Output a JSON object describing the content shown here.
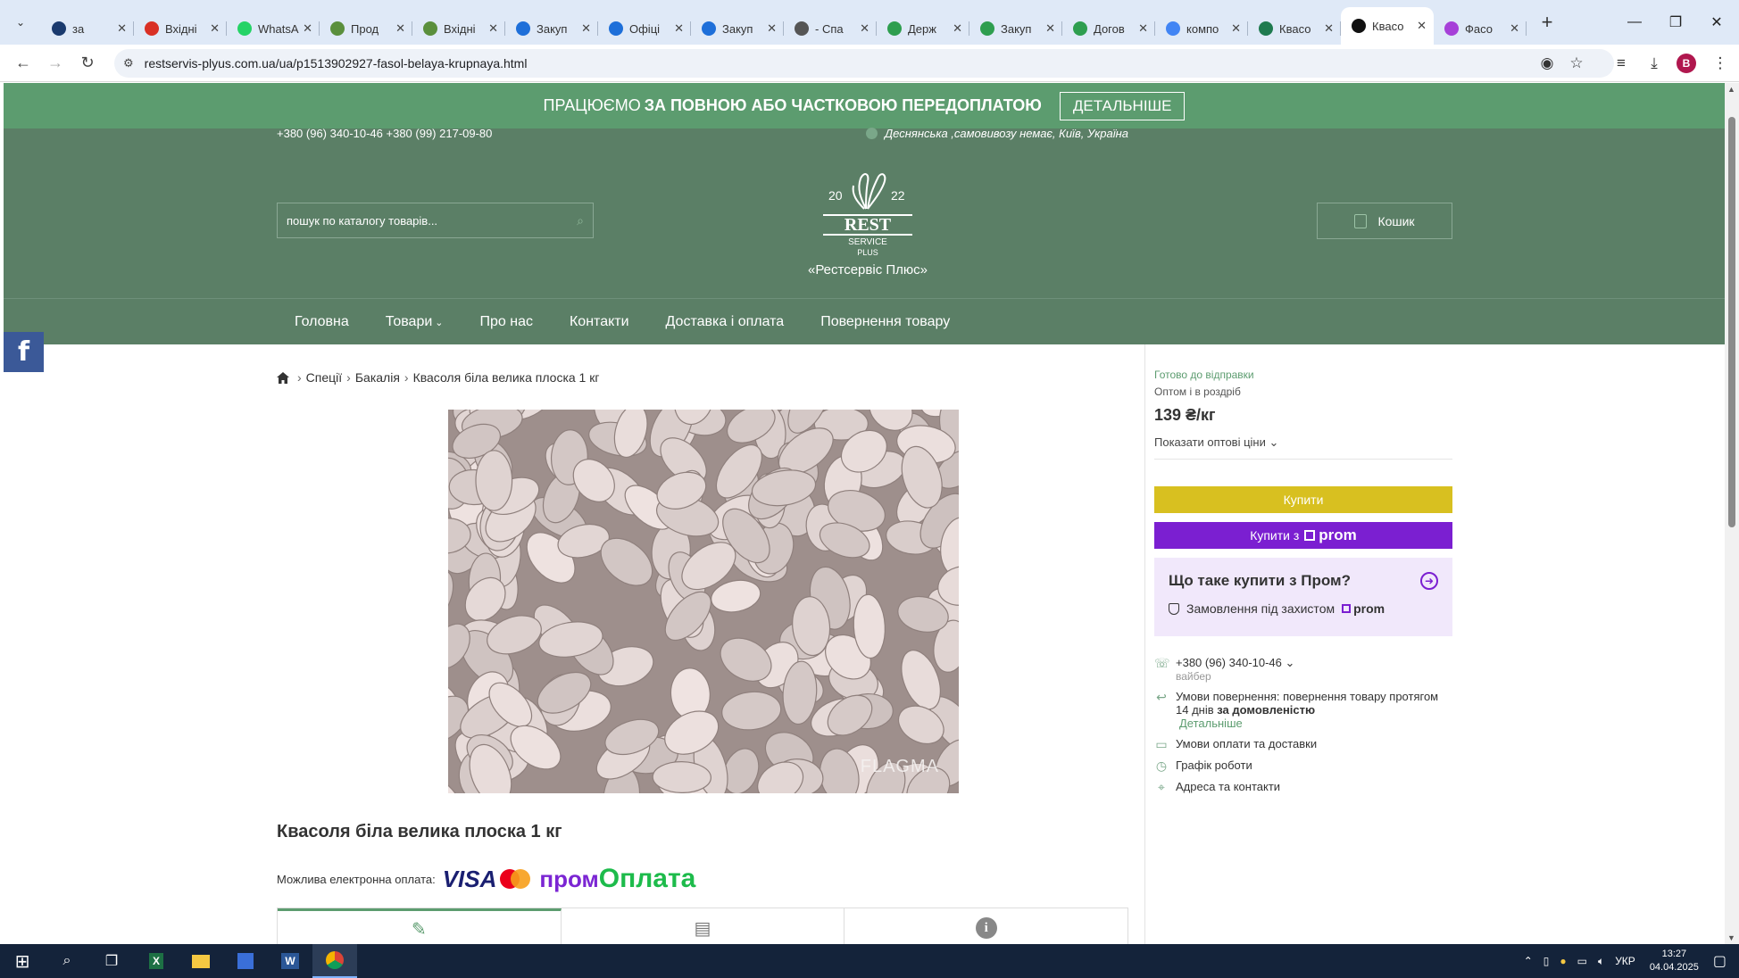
{
  "browser": {
    "tabs": [
      {
        "title": "за",
        "color": "#1a3a6e"
      },
      {
        "title": "Вхідні",
        "color": "#d93025"
      },
      {
        "title": "WhatsApp",
        "color": "#25d366"
      },
      {
        "title": "Прод",
        "color": "#5a8f3c"
      },
      {
        "title": "Вхідні",
        "color": "#5a8f3c"
      },
      {
        "title": "Закуп",
        "color": "#1e6fd9"
      },
      {
        "title": "Офіці",
        "color": "#1e6fd9"
      },
      {
        "title": "Закуп",
        "color": "#1e6fd9"
      },
      {
        "title": "- Спа",
        "color": "#555555"
      },
      {
        "title": "Держ",
        "color": "#2e9e4f"
      },
      {
        "title": "Закуп",
        "color": "#2e9e4f"
      },
      {
        "title": "Догов",
        "color": "#2e9e4f"
      },
      {
        "title": "компо",
        "color": "#4285f4"
      },
      {
        "title": "Квасо",
        "color": "#1f7a4f"
      },
      {
        "title": "Квасо",
        "color": "#111111",
        "active": true
      },
      {
        "title": "Фасо",
        "color": "#a640d8"
      }
    ],
    "url": "restservis-plyus.com.ua/ua/p1513902927-fasol-belaya-krupnaya.html",
    "profile_initial": "B"
  },
  "promo": {
    "text_light": "ПРАЦЮЄМО",
    "text_bold": "ЗА ПОВНОЮ АБО ЧАСТКОВОЮ ПЕРЕДОПЛАТОЮ",
    "button": "ДЕТАЛЬНІШЕ"
  },
  "header": {
    "phones": "+380 (96) 340-10-46 +380 (99) 217-09-80",
    "address": "Деснянська ,самовивозу немає, Київ, Україна",
    "search_placeholder": "пошук по каталогу товарів...",
    "company": "«Рестсервіс Плюс»",
    "cart": "Кошик",
    "logo": {
      "year_left": "20",
      "year_right": "22",
      "word": "REST",
      "sub1": "SERVICE",
      "sub2": "PLUS"
    }
  },
  "menu": [
    {
      "label": "Головна"
    },
    {
      "label": "Товари",
      "dropdown": true
    },
    {
      "label": "Про нас"
    },
    {
      "label": "Контакти"
    },
    {
      "label": "Доставка і оплата"
    },
    {
      "label": "Повернення товару"
    }
  ],
  "breadcrumbs": [
    "Спеції",
    "Бакалія",
    "Квасоля біла велика плоска 1 кг"
  ],
  "product": {
    "title": "Квасоля біла велика плоска 1 кг",
    "watermark": "FLAGMA",
    "payment_label": "Можлива електронна оплата:",
    "visa": "VISA",
    "prom_pay_a": "пром",
    "prom_pay_b": "Оплата"
  },
  "sidebar": {
    "status": "Готово до відправки",
    "sale_type": "Оптом і в роздріб",
    "price": "139 ₴/кг",
    "wholesale": "Показати оптові ціни",
    "buy": "Купити",
    "buy_prom": "Купити з",
    "prom_logo": "prom",
    "what_is": "Що таке купити з Пром?",
    "protected": "Замовлення під захистом",
    "phone": "+380 (96) 340-10-46",
    "phone_sub": "вайбер",
    "return_text": "Умови повернення: повернення товару протягом 14 днів",
    "return_bold": "за домовленістю",
    "return_more": "Детальніше",
    "payment_delivery": "Умови оплати та доставки",
    "schedule": "Графік роботи",
    "contacts": "Адреса та контакти"
  },
  "taskbar": {
    "lang": "УКР",
    "time": "13:27",
    "date": "04.04.2025"
  }
}
